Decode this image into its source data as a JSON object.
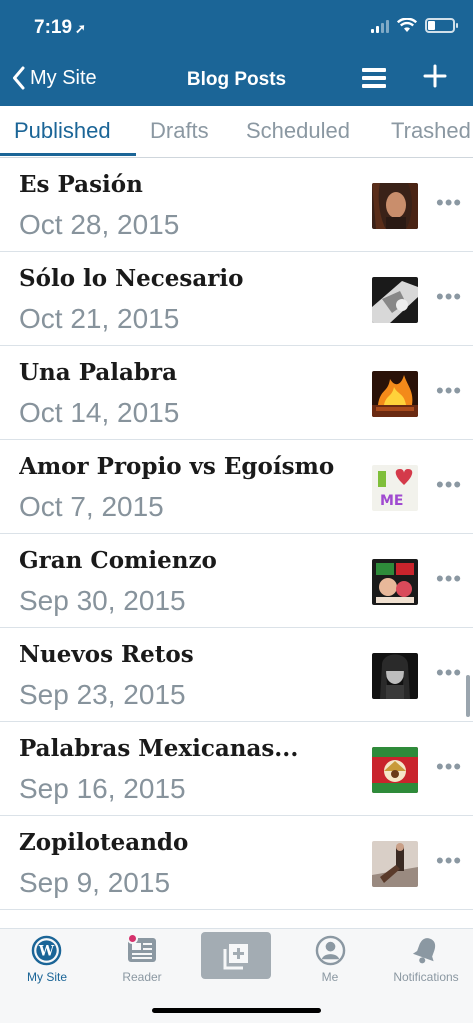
{
  "status_bar": {
    "time": "7:19",
    "location_arrow": "location-arrow-icon"
  },
  "nav": {
    "back_label": "My Site",
    "title": "Blog Posts"
  },
  "tabs": [
    {
      "label": "Published",
      "active": true
    },
    {
      "label": "Drafts",
      "active": false
    },
    {
      "label": "Scheduled",
      "active": false
    },
    {
      "label": "Trashed",
      "active": false
    }
  ],
  "posts": [
    {
      "title": "Es Pasión",
      "date": "Oct 28, 2015"
    },
    {
      "title": "Sólo lo Necesario",
      "date": "Oct 21, 2015"
    },
    {
      "title": "Una Palabra",
      "date": "Oct 14, 2015"
    },
    {
      "title": "Amor Propio vs Egoísmo",
      "date": "Oct 7, 2015"
    },
    {
      "title": "Gran Comienzo",
      "date": "Sep 30, 2015"
    },
    {
      "title": "Nuevos Retos",
      "date": "Sep 23, 2015"
    },
    {
      "title": "Palabras Mexicanas...",
      "date": "Sep 16, 2015"
    },
    {
      "title": "Zopiloteando",
      "date": "Sep 9, 2015"
    }
  ],
  "more_glyph": "•••",
  "tabbar": {
    "my_site": "My Site",
    "reader": "Reader",
    "me": "Me",
    "notifications": "Notifications"
  },
  "colors": {
    "brand": "#1b6597",
    "muted": "#8b98a2",
    "notification_dot": "#d5316c"
  }
}
